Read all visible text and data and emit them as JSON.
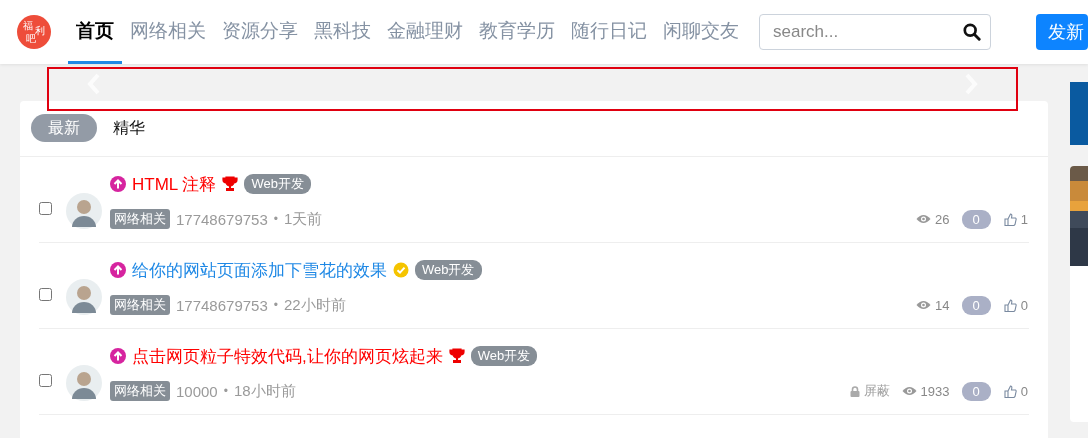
{
  "header": {
    "logo_text": [
      "福",
      "利",
      "吧"
    ],
    "nav": [
      {
        "label": "首页",
        "selected": true
      },
      {
        "label": "网络相关",
        "selected": false
      },
      {
        "label": "资源分享",
        "selected": false
      },
      {
        "label": "黑科技",
        "selected": false
      },
      {
        "label": "金融理财",
        "selected": false
      },
      {
        "label": "教育学历",
        "selected": false
      },
      {
        "label": "随行日记",
        "selected": false
      },
      {
        "label": "闲聊交友",
        "selected": false
      }
    ],
    "search": {
      "placeholder": "search..."
    },
    "post_button": "发新"
  },
  "feed_tabs": [
    {
      "label": "最新",
      "selected": true
    },
    {
      "label": "精华",
      "selected": false
    }
  ],
  "posts": [
    {
      "checked": false,
      "title": "HTML 注释",
      "color": "#ff0000",
      "badge": {
        "kind": "trophy"
      },
      "tag": "Web开发",
      "category": "网络相关",
      "author": "17748679753",
      "separator": "•",
      "time": "1天前",
      "views": "26",
      "comments": "0",
      "likes": "1"
    },
    {
      "checked": false,
      "title": "给你的网站页面添加下雪花的效果",
      "color": "#1e88e5",
      "badge": {
        "kind": "check"
      },
      "tag": "Web开发",
      "category": "网络相关",
      "author": "17748679753",
      "separator": "•",
      "time": "22小时前",
      "views": "14",
      "comments": "0",
      "likes": "0"
    },
    {
      "checked": false,
      "title": "点击网页粒子特效代码,让你的网页炫起来",
      "color": "#ff0000",
      "badge": {
        "kind": "trophy"
      },
      "tag": "Web开发",
      "category": "网络相关",
      "author": "10000",
      "separator": "•",
      "time": "18小时前",
      "locked": "屏蔽",
      "views": "1933",
      "comments": "0",
      "likes": "0"
    }
  ]
}
